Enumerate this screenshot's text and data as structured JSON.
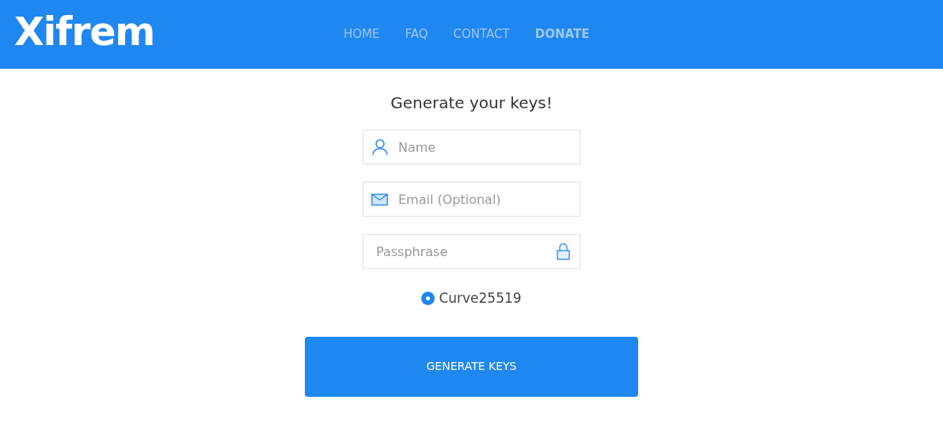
{
  "header": {
    "logo": "Xifrem",
    "nav": [
      {
        "label": "HOME",
        "selected": false
      },
      {
        "label": "FAQ",
        "selected": false
      },
      {
        "label": "CONTACT",
        "selected": false
      },
      {
        "label": "DONATE",
        "selected": true
      }
    ]
  },
  "form": {
    "title": "Generate your keys!",
    "fields": [
      {
        "kind": "person",
        "placeholder": "Name"
      },
      {
        "kind": "email",
        "placeholder": "Email (Optional)"
      },
      {
        "kind": "lock",
        "placeholder": "Passphrase"
      }
    ],
    "options": [
      {
        "label": "Curve25519",
        "selected": true
      }
    ],
    "button": "GENERATE KEYS"
  }
}
